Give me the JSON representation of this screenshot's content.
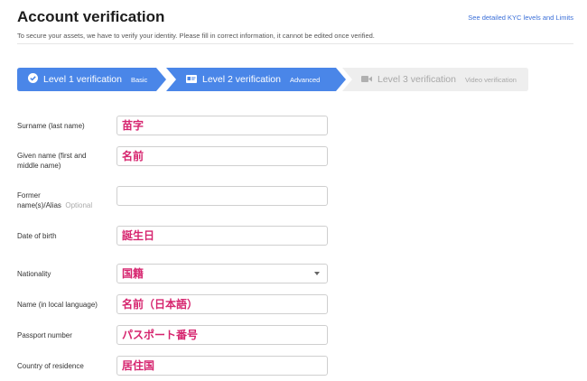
{
  "header": {
    "title": "Account verification",
    "subtitle": "To secure your assets, we have to verify your identity. Please fill in correct information, it cannot be edited once verified.",
    "kyc_link": "See detailed KYC levels and Limits"
  },
  "steps": [
    {
      "label": "Level 1 verification",
      "sub": "Basic",
      "icon": "check-circle-icon",
      "state": "completed"
    },
    {
      "label": "Level 2 verification",
      "sub": "Advanced",
      "icon": "id-card-icon",
      "state": "active"
    },
    {
      "label": "Level 3 verification",
      "sub": "Video verification",
      "icon": "video-camera-icon",
      "state": "locked"
    }
  ],
  "form": {
    "surname": {
      "label": "Surname (last name)",
      "value": "苗字"
    },
    "given_name": {
      "label_line1": "Given name (first and",
      "label_line2": "middle name)",
      "value": "名前"
    },
    "former_name": {
      "label_line1": "Former",
      "label_line2": "name(s)/Alias",
      "optional": "Optional",
      "value": ""
    },
    "dob": {
      "label": "Date of birth",
      "value": "誕生日"
    },
    "nationality": {
      "label": "Nationality",
      "value": "国籍"
    },
    "local_name": {
      "label": "Name (in local language)",
      "value": "名前（日本語）"
    },
    "passport": {
      "label": "Passport number",
      "value": "パスポート番号"
    },
    "residence": {
      "label": "Country of residence",
      "value": "居住国"
    }
  },
  "colors": {
    "step_active": "#4a86e8",
    "step_locked": "#eeeeee",
    "link": "#3b6fd8",
    "annotation_text": "#d6246e"
  }
}
